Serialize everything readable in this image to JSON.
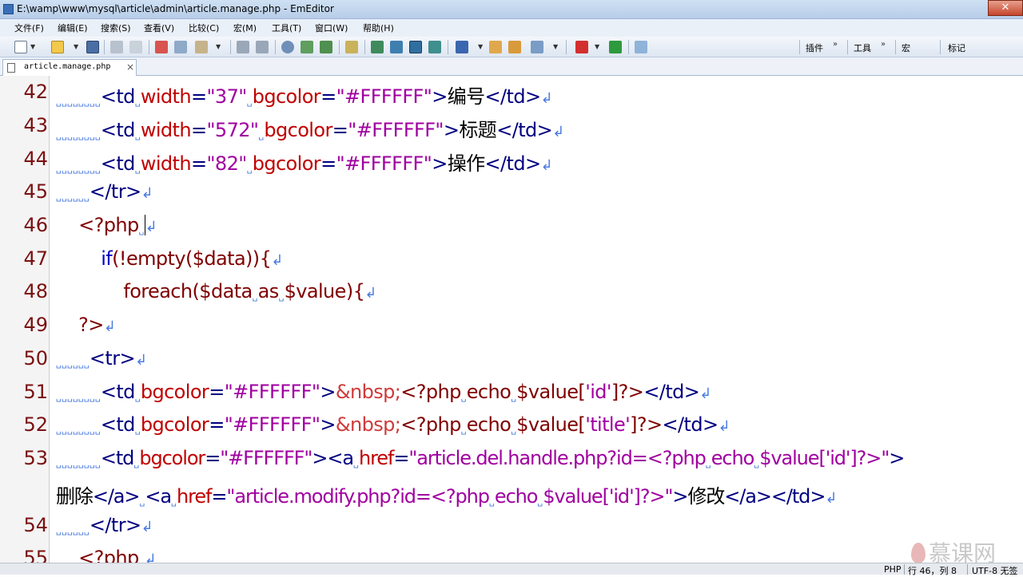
{
  "window": {
    "title": "E:\\wamp\\www\\mysql\\article\\admin\\article.manage.php - EmEditor",
    "close_glyph": "✕"
  },
  "menu": [
    "文件(F)",
    "编辑(E)",
    "搜索(S)",
    "查看(V)",
    "比较(C)",
    "宏(M)",
    "工具(T)",
    "窗口(W)",
    "帮助(H)"
  ],
  "toolbar": {
    "plugins_label": "插件",
    "tools_label": "工具",
    "macro_label": "宏",
    "marks_label": "标记",
    "chevron": "»"
  },
  "tabs": [
    {
      "name": "article.manage.php",
      "close_glyph": "×"
    }
  ],
  "editor": {
    "line_numbers": [
      "42",
      "43",
      "44",
      "45",
      "46",
      "47",
      "48",
      "49",
      "50",
      "51",
      "52",
      "53",
      "54",
      "55"
    ],
    "lines": {
      "l42": {
        "ws": "␣␣␣␣␣␣␣␣",
        "t1": "<td",
        "s1": "␣",
        "a1": "width",
        "e1": "=",
        "v1": "\"37\"",
        "s2": "␣",
        "a2": "bgcolor",
        "e2": "=",
        "v2": "\"#FFFFFF\"",
        "t2": ">",
        "txt": "编号",
        "t3": "</td>",
        "eol": "↲"
      },
      "l43": {
        "ws": "␣␣␣␣␣␣␣␣",
        "t1": "<td",
        "s1": "␣",
        "a1": "width",
        "e1": "=",
        "v1": "\"572\"",
        "s2": "␣",
        "a2": "bgcolor",
        "e2": "=",
        "v2": "\"#FFFFFF\"",
        "t2": ">",
        "txt": "标题",
        "t3": "</td>",
        "eol": "↲"
      },
      "l44": {
        "ws": "␣␣␣␣␣␣␣␣",
        "t1": "<td",
        "s1": "␣",
        "a1": "width",
        "e1": "=",
        "v1": "\"82\"",
        "s2": "␣",
        "a2": "bgcolor",
        "e2": "=",
        "v2": "\"#FFFFFF\"",
        "t2": ">",
        "txt": "操作",
        "t3": "</td>",
        "eol": "↲"
      },
      "l45": {
        "ws": "␣␣␣␣␣␣",
        "t1": "</tr>",
        "eol": "↲"
      },
      "l46": {
        "pad": "    ",
        "p1": "<?php",
        "s1": "␣",
        "eol": "↲"
      },
      "l47": {
        "pad": "        ",
        "k1": "if",
        "p1": "(!",
        "f1": "empty",
        "p2": "($data)){",
        "eol": "↲"
      },
      "l48": {
        "pad": "            ",
        "f1": "foreach",
        "p1": "($data",
        "s1": "␣",
        "k1": "as",
        "s2": "␣",
        "p2": "$value){",
        "eol": "↲"
      },
      "l49": {
        "pad": "    ",
        "p1": "?>",
        "eol": "↲"
      },
      "l50": {
        "ws": "␣␣␣␣␣␣",
        "t1": "<tr>",
        "eol": "↲"
      },
      "l51": {
        "ws": "␣␣␣␣␣␣␣␣",
        "t1": "<td",
        "s1": "␣",
        "a1": "bgcolor",
        "e1": "=",
        "v1": "\"#FFFFFF\"",
        "t2": ">",
        "ent": "&nbsp;",
        "p1": "<?php",
        "s2": "␣",
        "k1": "echo",
        "s3": "␣",
        "p2": "$value[",
        "q1": "'id'",
        "p3": "]?>",
        "t3": "</td>",
        "eol": "↲"
      },
      "l52": {
        "ws": "␣␣␣␣␣␣␣␣",
        "t1": "<td",
        "s1": "␣",
        "a1": "bgcolor",
        "e1": "=",
        "v1": "\"#FFFFFF\"",
        "t2": ">",
        "ent": "&nbsp;",
        "p1": "<?php",
        "s2": "␣",
        "k1": "echo",
        "s3": "␣",
        "p2": "$value[",
        "q1": "'title'",
        "p3": "]?>",
        "t3": "</td>",
        "eol": "↲"
      },
      "l53a": {
        "ws": "␣␣␣␣␣␣␣␣",
        "t1": "<td",
        "s1": "␣",
        "a1": "bgcolor",
        "e1": "=",
        "v1": "\"#FFFFFF\"",
        "t2": ">",
        "t3": "<a",
        "s2": "␣",
        "a2": "href",
        "e2": "=",
        "v2": "\"article.del.handle.php?id=<?php",
        "s3": "␣",
        "v3": "echo",
        "s4": "␣",
        "v4": "$value['id']?>\"",
        "t4": ">"
      },
      "l53b": {
        "txt1": "删除",
        "t1": "</a>",
        "s1": "␣",
        "t2": "<a",
        "s2": "␣",
        "a1": "href",
        "e1": "=",
        "v1": "\"article.modify.php?id=<?php",
        "s3": "␣",
        "v2": "echo",
        "s4": "␣",
        "v3": "$value['id']?>\"",
        "t3": ">",
        "txt2": "修改",
        "t4": "</a>",
        "t5": "</td>",
        "eol": "↲"
      },
      "l54": {
        "ws": "␣␣␣␣␣␣",
        "t1": "</tr>",
        "eol": "↲"
      },
      "l55": {
        "pad": "    ",
        "p1": "<?php",
        "s1": "␣",
        "eol": "↲"
      }
    }
  },
  "status": {
    "mode": "PHP",
    "position": "行 46，列 8",
    "encoding": "UTF-8 无签"
  },
  "watermark": "慕课网",
  "colors": {
    "tag": "#000080",
    "attribute": "#c00000",
    "string": "#a000a0",
    "php": "#800000",
    "keyword": "#0000c0",
    "line_number": "#7a1010"
  }
}
